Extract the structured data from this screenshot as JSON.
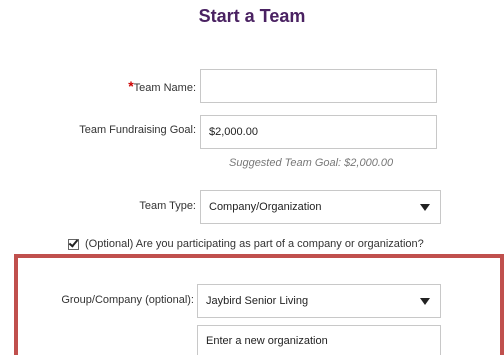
{
  "form": {
    "title": "Start a Team",
    "team_name": {
      "required_marker": "*",
      "label": "Team Name:",
      "value": ""
    },
    "fundraising_goal": {
      "label": "Team Fundraising Goal:",
      "value": "$2,000.00",
      "hint": "Suggested Team Goal: $2,000.00"
    },
    "team_type": {
      "label": "Team Type:",
      "selected": "Company/Organization"
    },
    "company_checkbox": {
      "checked": true,
      "label": "(Optional) Are you participating as part of a company or organization?"
    },
    "group_company": {
      "label": "Group/Company (optional):",
      "selected": "Jaybird Senior Living"
    },
    "new_org": {
      "placeholder": "Enter a new organization"
    }
  },
  "highlight": {
    "color": "#c0504d"
  }
}
